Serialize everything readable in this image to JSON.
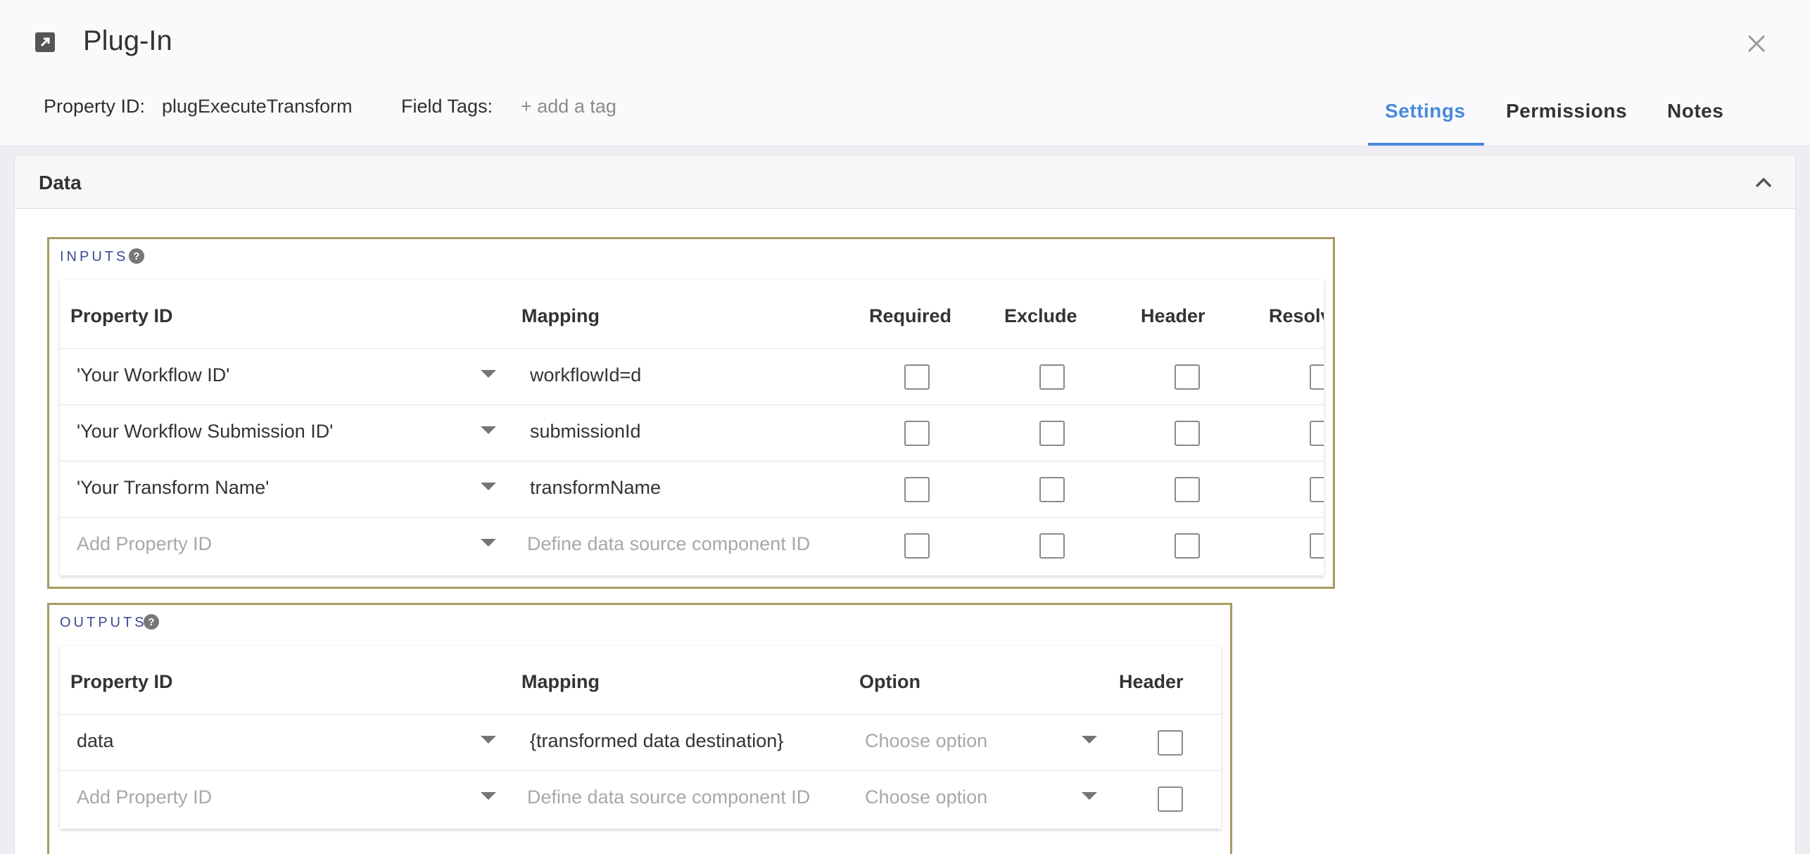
{
  "header": {
    "title": "Plug-In",
    "icon": "external-link-icon",
    "property_id_label": "Property ID:",
    "property_id_value": "plugExecuteTransform",
    "field_tags_label": "Field Tags:",
    "add_tag_label": "+ add a tag",
    "close_icon": "close-icon"
  },
  "tabs": [
    {
      "label": "Settings",
      "active": true
    },
    {
      "label": "Permissions",
      "active": false
    },
    {
      "label": "Notes",
      "active": false
    }
  ],
  "panel": {
    "title": "Data",
    "collapse_icon": "chevron-up-icon"
  },
  "inputs": {
    "label": "INPUTS",
    "columns": [
      "Property ID",
      "Mapping",
      "Required",
      "Exclude",
      "Header",
      "Resolve"
    ],
    "rows": [
      {
        "property_id": "'Your Workflow ID'",
        "mapping": "workflowId=d",
        "placeholder": false
      },
      {
        "property_id": "'Your Workflow Submission ID'",
        "mapping": "submissionId",
        "placeholder": false
      },
      {
        "property_id": "'Your Transform Name'",
        "mapping": "transformName",
        "placeholder": false
      },
      {
        "property_id": "Add Property ID",
        "mapping": "Define data source component ID",
        "placeholder": true
      }
    ]
  },
  "outputs": {
    "label": "OUTPUTS",
    "columns": [
      "Property ID",
      "Mapping",
      "Option",
      "Header"
    ],
    "rows": [
      {
        "property_id": "data",
        "mapping": "{transformed data destination}",
        "option": "Choose option",
        "placeholder": false
      },
      {
        "property_id": "Add Property ID",
        "mapping": "Define data source component ID",
        "option": "Choose option",
        "placeholder": true
      }
    ]
  },
  "colors": {
    "accent": "#4a89dc",
    "section_border": "#a89a62",
    "section_label": "#3f4a8f"
  }
}
